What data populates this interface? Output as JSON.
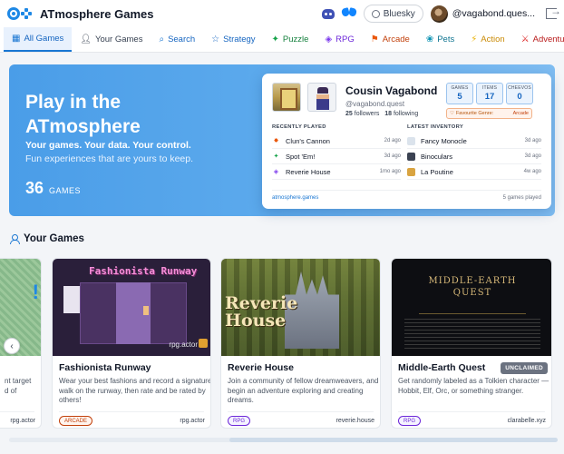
{
  "header": {
    "brand": "ATmosphere Games",
    "bluesky_label": "Bluesky",
    "user_handle": "@vagabond.ques..."
  },
  "nav": {
    "tabs": [
      {
        "label": "All Games",
        "icon": "grid-icon",
        "active": true
      },
      {
        "label": "Your Games",
        "icon": "person-icon"
      },
      {
        "label": "Search",
        "icon": "search-icon"
      },
      {
        "label": "Strategy",
        "icon": "star-icon"
      },
      {
        "label": "Puzzle",
        "icon": "puzzle-icon"
      },
      {
        "label": "RPG",
        "icon": "gamepad-icon"
      },
      {
        "label": "Arcade",
        "icon": "arcade-icon"
      },
      {
        "label": "Pets",
        "icon": "paw-icon"
      },
      {
        "label": "Action",
        "icon": "lightning-icon"
      },
      {
        "label": "Adventure",
        "icon": "sword-icon"
      }
    ]
  },
  "hero": {
    "title": "Play in the ATmosphere",
    "tagline": "Your games. Your data. Your control.",
    "subtitle": "Fun experiences that are yours to keep.",
    "game_count": "36",
    "game_count_label": "GAMES"
  },
  "profile": {
    "name": "Cousin Vagabond",
    "handle": "@vagabond.quest",
    "followers": "25",
    "followers_label": "followers",
    "following": "18",
    "following_label": "following",
    "stats": [
      {
        "label": "GAMES",
        "value": "5"
      },
      {
        "label": "ITEMS",
        "value": "17"
      },
      {
        "label": "CHEEVOS",
        "value": "0"
      }
    ],
    "favourite_label": "Favourite Genre:",
    "favourite_genre": "Arcade",
    "recent_title": "RECENTLY PLAYED",
    "recent": [
      {
        "name": "Clun's Cannon",
        "date": "2d ago"
      },
      {
        "name": "Spot 'Em!",
        "date": "3d ago"
      },
      {
        "name": "Reverie House",
        "date": "1mo ago"
      }
    ],
    "inventory_title": "LATEST INVENTORY",
    "inventory": [
      {
        "name": "Fancy Monocle",
        "date": "3d ago"
      },
      {
        "name": "Binoculars",
        "date": "3d ago"
      },
      {
        "name": "La Poutine",
        "date": "4w ago"
      }
    ],
    "site": "atmosphere.games",
    "games_played": "5 games played"
  },
  "your_games": {
    "title": "Your Games",
    "cards": [
      {
        "title": "",
        "desc": "nt target\nd of",
        "tag": "",
        "site": "rpg.actor"
      },
      {
        "title": "Fashionista Runway",
        "image_text": "Fashionista Runway",
        "image_badge": "rpg.actor",
        "desc": "Wear your best fashions and record a signature walk on the runway, then rate and be rated by others!",
        "tag": "ARCADE",
        "site": "rpg.actor"
      },
      {
        "title": "Reverie House",
        "image_text": "Reverie House",
        "desc": "Join a community of fellow dreamweavers, and begin an adventure exploring and creating dreams.",
        "tag": "RPG",
        "site": "reverie.house"
      },
      {
        "title": "Middle-Earth Quest",
        "image_text": "MIDDLE-EARTH QUEST",
        "badge": "UNCLAIMED",
        "desc": "Get randomly labeled as a Tolkien character — Hobbit, Elf, Orc, or something stranger.",
        "tag": "RPG",
        "site": "clarabelle.xyz"
      }
    ]
  }
}
